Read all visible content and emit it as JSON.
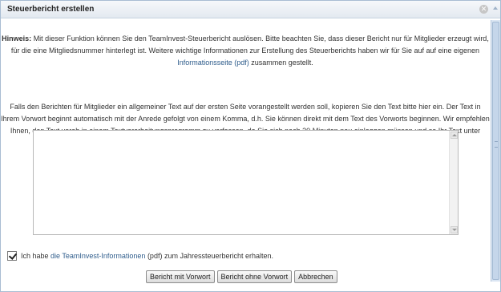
{
  "dialog": {
    "title": "Steuerbericht erstellen",
    "close_icon": "close-icon"
  },
  "hint": {
    "label": "Hinweis:",
    "text_1": " Mit dieser Funktion können Sie den TeamInvest-Steuerbericht auslösen. Bitte beachten Sie, dass dieser Bericht nur für Mitglieder erzeugt wird, für die eine Mitgliedsnummer hinterlegt ist. Weitere wichtige Informationen zur Erstellung des Steuerberichts haben wir für Sie auf auf eine eigenen ",
    "link": "Informationsseite (pdf)",
    "text_2": " zusammen gestellt."
  },
  "info": {
    "text": "Falls den Berichten für Mitglieder ein allgemeiner Text auf der ersten Seite vorangestellt werden soll, kopieren Sie den Text bitte hier ein. Der Text in Ihrem Vorwort beginnt automatisch mit der Anrede gefolgt von einem Komma, d.h. Sie können direkt mit dem Text des Vorworts beginnen. Wir empfehlen Ihnen, den Text vorab in einem Textverarbeitungsprogramm zu verfassen, da Sie sich nach 30 Minuten neu einloggen müssen und so Ihr Text unter Umständen verloren gehen könnte."
  },
  "preface": {
    "value": ""
  },
  "confirm": {
    "checked": true,
    "text_1": "Ich habe ",
    "link": "die TeamInvest-Informationen",
    "text_2": " (pdf) zum Jahressteuerbericht erhalten."
  },
  "buttons": {
    "with_preface": "Bericht mit Vorwort",
    "without_preface": "Bericht ohne Vorwort",
    "cancel": "Abbrechen"
  },
  "colors": {
    "link": "#2f5d8c",
    "title_bg": "#e3e9f0",
    "scrollbar": "#c5d6ea"
  }
}
